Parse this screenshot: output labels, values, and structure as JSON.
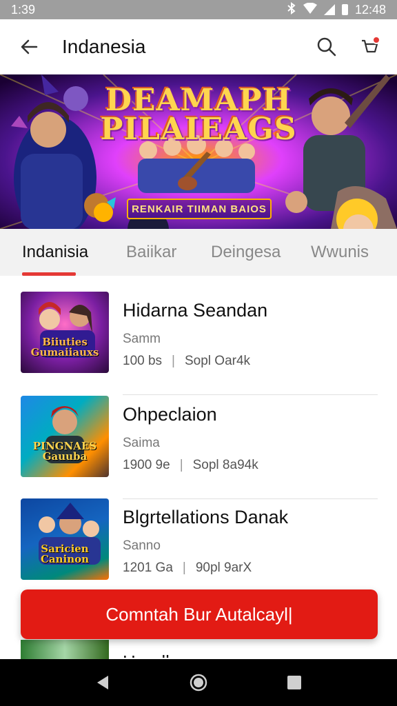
{
  "status_bar": {
    "time_left": "1:39",
    "time_right": "12:48",
    "icons": [
      "bluetooth-icon",
      "wifi-icon",
      "signal-icon",
      "battery-icon"
    ]
  },
  "app_bar": {
    "title": "Indanesia",
    "icons": [
      "back-arrow-icon",
      "search-icon",
      "cart-icon"
    ]
  },
  "banner": {
    "title_line1": "DEAMAPH",
    "title_line2": "PILAIEAGS",
    "subtitle": "RENKAIR TIIMAN BAIOS"
  },
  "tabs": [
    {
      "label": "Indanisia",
      "active": true
    },
    {
      "label": "Baiikar",
      "active": false
    },
    {
      "label": "Deingesa",
      "active": false
    },
    {
      "label": "Wwunis",
      "active": false
    }
  ],
  "items": [
    {
      "title": "Hidarna Seandan",
      "subtitle": "Samm",
      "meta_left": "100 bs",
      "meta_right": "Sopl Oar4k",
      "thumb_text": "Biiuties Gumaiiauxs"
    },
    {
      "title": "Ohpeclaion",
      "subtitle": "Saima",
      "meta_left": "1900 9e",
      "meta_right": "Sopl 8a94k",
      "thumb_text": "PINGNAES Gauuba"
    },
    {
      "title": "Blgrtellations Danak",
      "subtitle": "Sanno",
      "meta_left": "1201 Ga",
      "meta_right": "90pl 9arX",
      "thumb_text": "Saricien Caninon"
    }
  ],
  "peek_item": {
    "title": "Handlan"
  },
  "cta": {
    "label": "Comntah Bur Autalcayl|"
  },
  "colors": {
    "accent": "#e21b14",
    "tab_indicator": "#e53935",
    "status_bar": "#9e9e9e",
    "nav_bar": "#000000"
  }
}
